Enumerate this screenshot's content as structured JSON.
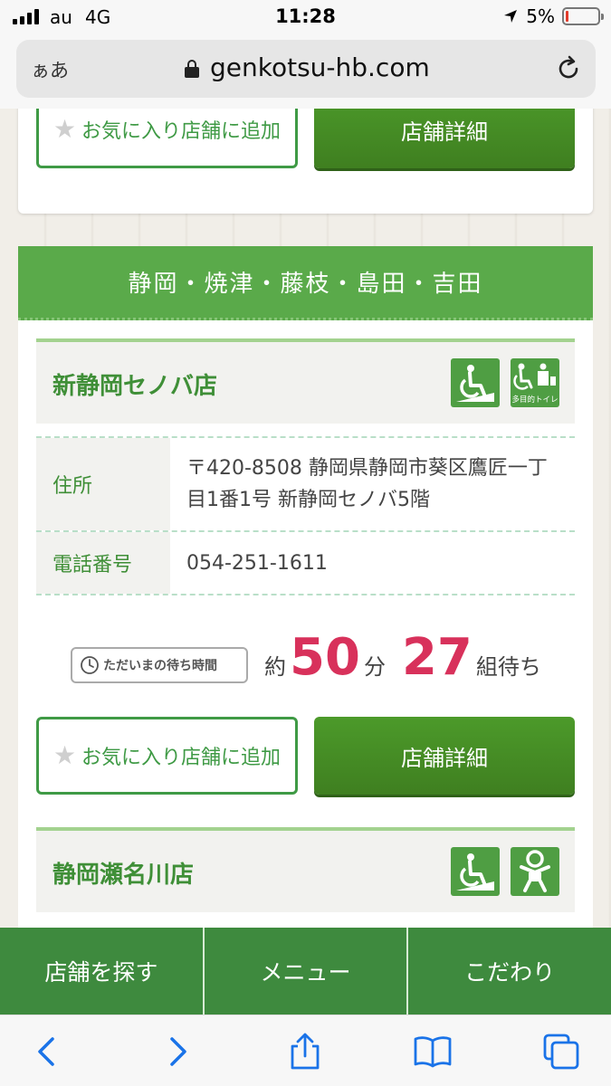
{
  "status_bar": {
    "carrier": "au",
    "network": "4G",
    "time": "11:28",
    "battery_percent": "5%"
  },
  "browser": {
    "aa_label": "ぁあ",
    "domain": "genkotsu-hb.com"
  },
  "buttons": {
    "favorite_label": "お気に入り店舗に追加",
    "detail_label": "店舗詳細"
  },
  "region": {
    "title": "静岡・焼津・藤枝・島田・吉田"
  },
  "stores": [
    {
      "name": "新静岡セノバ店",
      "address_label": "住所",
      "address": "〒420-8508 静岡県静岡市葵区鷹匠一丁目1番1号 新静岡セノバ5階",
      "phone_label": "電話番号",
      "phone": "054-251-1611",
      "wait": {
        "badge": "ただいまの待ち時間",
        "prefix": "約",
        "minutes": "50",
        "minutes_unit": "分",
        "groups": "27",
        "groups_unit": "組待ち"
      },
      "facilities": [
        "wheelchair-icon",
        "multipurpose-toilet-icon"
      ],
      "toilet_label": "多目的トイレ"
    },
    {
      "name": "静岡瀬名川店",
      "facilities": [
        "wheelchair-icon",
        "baby-icon"
      ]
    }
  ],
  "site_nav": [
    {
      "label": "店舗を探す"
    },
    {
      "label": "メニュー"
    },
    {
      "label": "こだわり"
    }
  ],
  "colors": {
    "brand_green": "#3f9a45",
    "nav_green": "#3e8a3e",
    "wait_red": "#d8315b"
  }
}
